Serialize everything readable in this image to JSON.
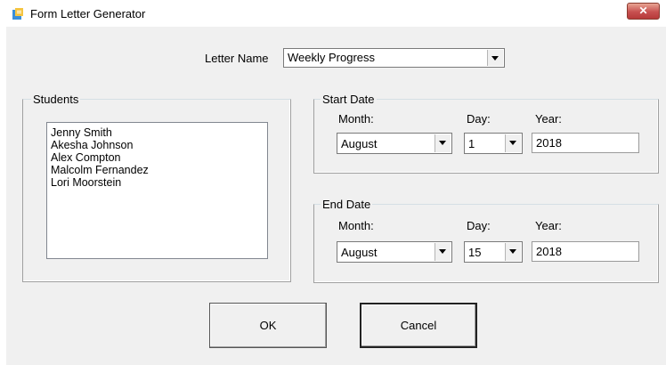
{
  "window": {
    "title": "Form Letter Generator",
    "close_glyph": "✕",
    "icon": "app-icon"
  },
  "letter": {
    "label": "Letter Name",
    "value": "Weekly Progress"
  },
  "students": {
    "title": "Students",
    "items": [
      "Jenny Smith",
      "Akesha Johnson",
      "Alex Compton",
      "Malcolm Fernandez",
      "Lori Moorstein"
    ]
  },
  "start_date": {
    "title": "Start Date",
    "month_label": "Month:",
    "day_label": "Day:",
    "year_label": "Year:",
    "month": "August",
    "day": "1",
    "year": "2018"
  },
  "end_date": {
    "title": "End Date",
    "month_label": "Month:",
    "day_label": "Day:",
    "year_label": "Year:",
    "month": "August",
    "day": "15",
    "year": "2018"
  },
  "buttons": {
    "ok": "OK",
    "cancel": "Cancel"
  },
  "colors": {
    "dialog_bg": "#f0f0f0",
    "close_button": "#c75050"
  }
}
